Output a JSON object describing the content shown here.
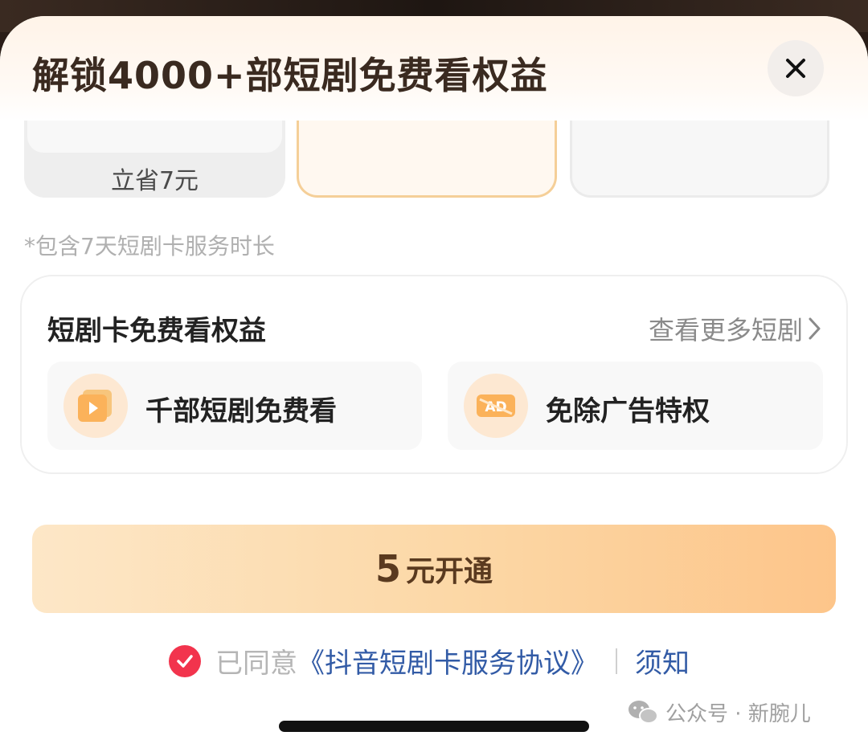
{
  "header": {
    "title": "解锁4000+部短剧免费看权益"
  },
  "plans": {
    "left_savings": "立省7元"
  },
  "note": "*包含7天短剧卡服务时长",
  "benefits": {
    "title": "短剧卡免费看权益",
    "more_link": "查看更多短剧",
    "items": [
      {
        "label": "千部短剧免费看",
        "icon": "video-play-icon"
      },
      {
        "label": "免除广告特权",
        "icon": "ad-free-icon"
      }
    ]
  },
  "cta": {
    "amount": "5",
    "label": "元开通"
  },
  "agreement": {
    "prefix": "已同意",
    "link": "《抖音短剧卡服务协议》",
    "notice": "须知"
  },
  "watermark": {
    "text": "公众号 · 新腕儿"
  },
  "colors": {
    "accent": "#f2344d",
    "link": "#325ba6",
    "cta_start": "#fde7c7",
    "cta_end": "#fdc58a",
    "title": "#3a2a20"
  }
}
